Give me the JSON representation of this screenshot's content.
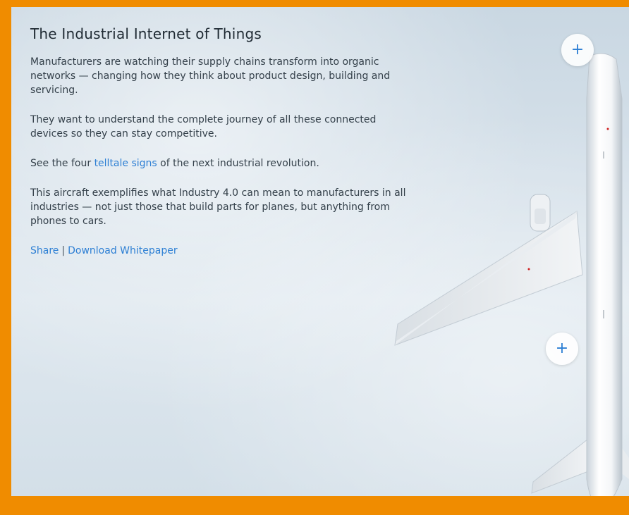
{
  "article": {
    "title": "The Industrial Internet of Things",
    "paragraphs": [
      "Manufacturers are watching their supply chains transform into organic networks — changing how they think about product design, building and servicing.",
      "They want to understand the complete journey of all these connected devices so they can stay competitive."
    ],
    "signs_prefix": "See the four ",
    "signs_link": "telltale signs",
    "signs_suffix": " of the next industrial revolution.",
    "closing": "This aircraft exemplifies what Industry 4.0 can mean to manufacturers in all industries — not just those that build parts for planes, but anything from phones to cars.",
    "share_label": "Share",
    "separator": "|",
    "download_label": "Download Whitepaper"
  },
  "hotspots": [
    {
      "icon": "plus-icon",
      "glyph": "+"
    },
    {
      "icon": "plus-icon",
      "glyph": "+"
    }
  ],
  "colors": {
    "frame": "#f08c00",
    "link": "#2d7fd4",
    "text": "#34404a"
  }
}
